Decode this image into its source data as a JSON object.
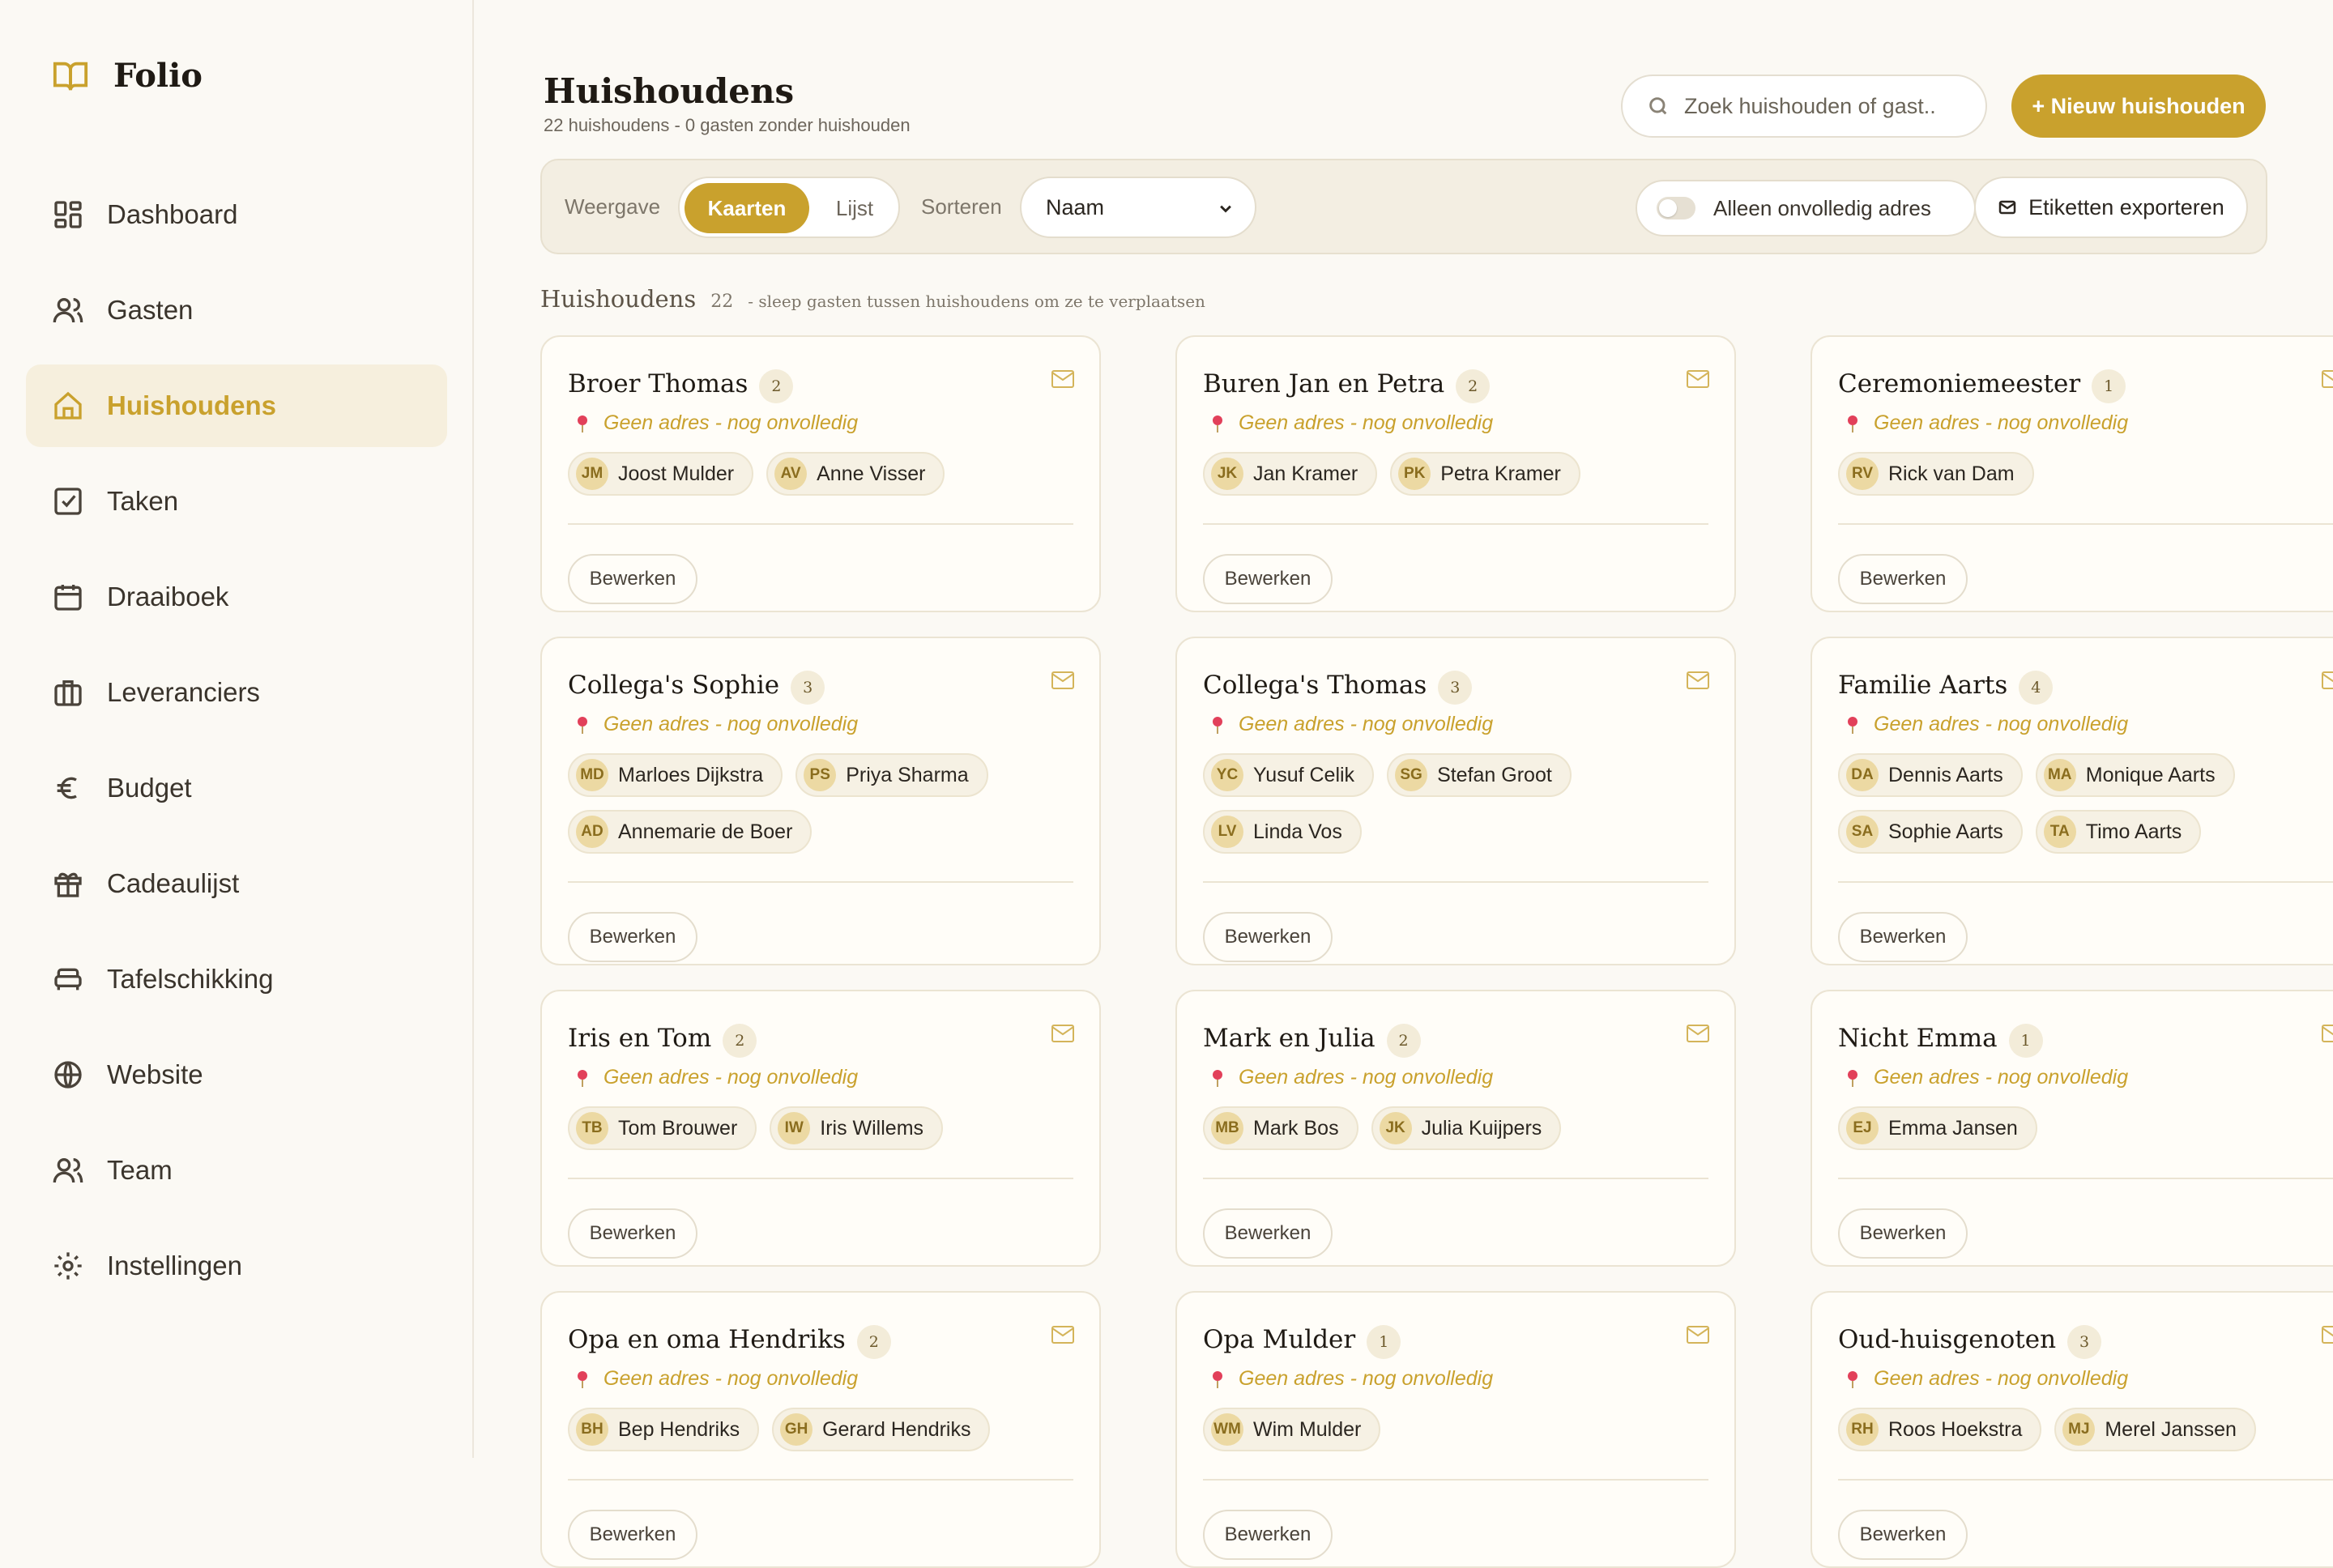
{
  "app": {
    "name": "Folio"
  },
  "nav": [
    {
      "label": "Dashboard",
      "icon": "dashboard-icon",
      "active": false
    },
    {
      "label": "Gasten",
      "icon": "users-icon",
      "active": false
    },
    {
      "label": "Huishoudens",
      "icon": "home-icon",
      "active": true
    },
    {
      "label": "Taken",
      "icon": "checkbox-icon",
      "active": false
    },
    {
      "label": "Draaiboek",
      "icon": "calendar-icon",
      "active": false
    },
    {
      "label": "Leveranciers",
      "icon": "briefcase-icon",
      "active": false
    },
    {
      "label": "Budget",
      "icon": "euro-icon",
      "active": false
    },
    {
      "label": "Cadeaulijst",
      "icon": "gift-icon",
      "active": false
    },
    {
      "label": "Tafelschikking",
      "icon": "sofa-icon",
      "active": false
    },
    {
      "label": "Website",
      "icon": "globe-icon",
      "active": false
    },
    {
      "label": "Team",
      "icon": "users-icon",
      "active": false
    },
    {
      "label": "Instellingen",
      "icon": "gear-icon",
      "active": false
    }
  ],
  "header": {
    "title": "Huishoudens",
    "subtitle": "22 huishoudens - 0 gasten zonder huishouden",
    "search_placeholder": "Zoek huishouden of gast..",
    "new_button": "+ Nieuw huishouden"
  },
  "toolbar": {
    "view_label": "Weergave",
    "view_cards": "Kaarten",
    "view_list": "Lijst",
    "sort_label": "Sorteren",
    "sort_value": "Naam",
    "incomplete_toggle": "Alleen onvolledig adres",
    "export_button": "Etiketten exporteren"
  },
  "section": {
    "title": "Huishoudens",
    "count": "22",
    "hint": "- sleep gasten tussen huishoudens om ze te verplaatsen"
  },
  "card_labels": {
    "address": "Geen adres - nog onvolledig",
    "edit": "Bewerken"
  },
  "households": [
    {
      "name": "Broer Thomas",
      "count": "2",
      "guests": [
        {
          "initials": "JM",
          "name": "Joost Mulder"
        },
        {
          "initials": "AV",
          "name": "Anne Visser"
        }
      ]
    },
    {
      "name": "Buren Jan en Petra",
      "count": "2",
      "guests": [
        {
          "initials": "JK",
          "name": "Jan Kramer"
        },
        {
          "initials": "PK",
          "name": "Petra Kramer"
        }
      ]
    },
    {
      "name": "Ceremoniemeester",
      "count": "1",
      "guests": [
        {
          "initials": "RV",
          "name": "Rick van Dam"
        }
      ]
    },
    {
      "name": "Collega's Sophie",
      "count": "3",
      "guests": [
        {
          "initials": "MD",
          "name": "Marloes Dijkstra"
        },
        {
          "initials": "PS",
          "name": "Priya Sharma"
        },
        {
          "initials": "AD",
          "name": "Annemarie de Boer"
        }
      ]
    },
    {
      "name": "Collega's Thomas",
      "count": "3",
      "guests": [
        {
          "initials": "YC",
          "name": "Yusuf Celik"
        },
        {
          "initials": "SG",
          "name": "Stefan Groot"
        },
        {
          "initials": "LV",
          "name": "Linda Vos"
        }
      ]
    },
    {
      "name": "Familie Aarts",
      "count": "4",
      "guests": [
        {
          "initials": "DA",
          "name": "Dennis Aarts"
        },
        {
          "initials": "MA",
          "name": "Monique Aarts"
        },
        {
          "initials": "SA",
          "name": "Sophie Aarts"
        },
        {
          "initials": "TA",
          "name": "Timo Aarts"
        }
      ]
    },
    {
      "name": "Iris en Tom",
      "count": "2",
      "guests": [
        {
          "initials": "TB",
          "name": "Tom Brouwer"
        },
        {
          "initials": "IW",
          "name": "Iris Willems"
        }
      ]
    },
    {
      "name": "Mark en Julia",
      "count": "2",
      "guests": [
        {
          "initials": "MB",
          "name": "Mark Bos"
        },
        {
          "initials": "JK",
          "name": "Julia Kuijpers"
        }
      ]
    },
    {
      "name": "Nicht Emma",
      "count": "1",
      "guests": [
        {
          "initials": "EJ",
          "name": "Emma Jansen"
        }
      ]
    },
    {
      "name": "Opa en oma Hendriks",
      "count": "2",
      "guests": [
        {
          "initials": "BH",
          "name": "Bep Hendriks"
        },
        {
          "initials": "GH",
          "name": "Gerard Hendriks"
        }
      ]
    },
    {
      "name": "Opa Mulder",
      "count": "1",
      "guests": [
        {
          "initials": "WM",
          "name": "Wim Mulder"
        }
      ]
    },
    {
      "name": "Oud-huisgenoten",
      "count": "3",
      "guests": [
        {
          "initials": "RH",
          "name": "Roos Hoekstra"
        },
        {
          "initials": "MJ",
          "name": "Merel Janssen"
        }
      ]
    }
  ],
  "colors": {
    "accent": "#c9a12d",
    "active_bg": "#f6efdd",
    "pin": "#e2405a"
  }
}
